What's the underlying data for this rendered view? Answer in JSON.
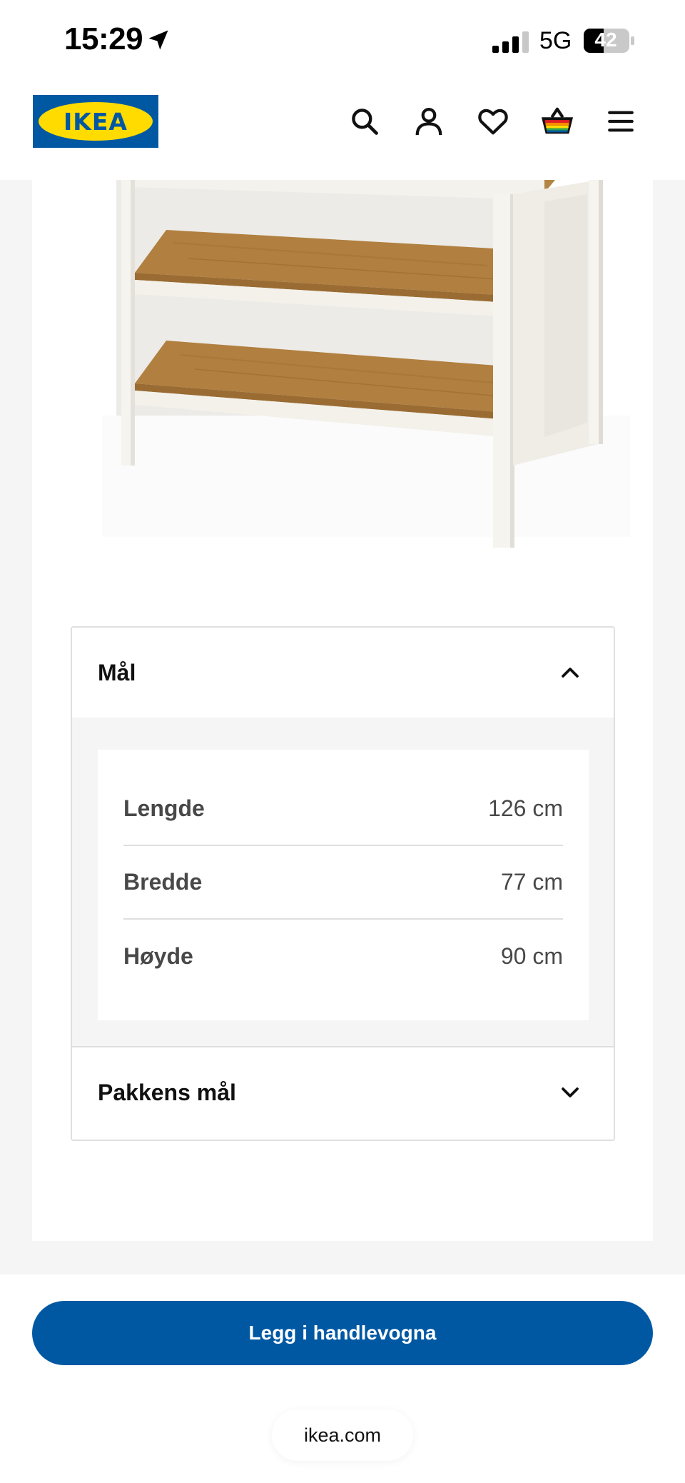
{
  "status_bar": {
    "time": "15:29",
    "network": "5G",
    "battery": "42"
  },
  "header": {
    "logo_text": "IKEA",
    "icons": [
      "search-icon",
      "account-icon",
      "heart-icon",
      "basket-icon",
      "menu-icon"
    ]
  },
  "accordion": {
    "dimensions": {
      "title": "Mål",
      "rows": [
        {
          "label": "Lengde",
          "value": "126 cm"
        },
        {
          "label": "Bredde",
          "value": "77 cm"
        },
        {
          "label": "Høyde",
          "value": "90 cm"
        }
      ]
    },
    "package": {
      "title": "Pakkens mål"
    }
  },
  "cta": {
    "label": "Legg i handlevogna"
  },
  "browser": {
    "domain": "ikea.com"
  },
  "colors": {
    "brand_blue": "#0058a3",
    "brand_yellow": "#ffdb00"
  }
}
